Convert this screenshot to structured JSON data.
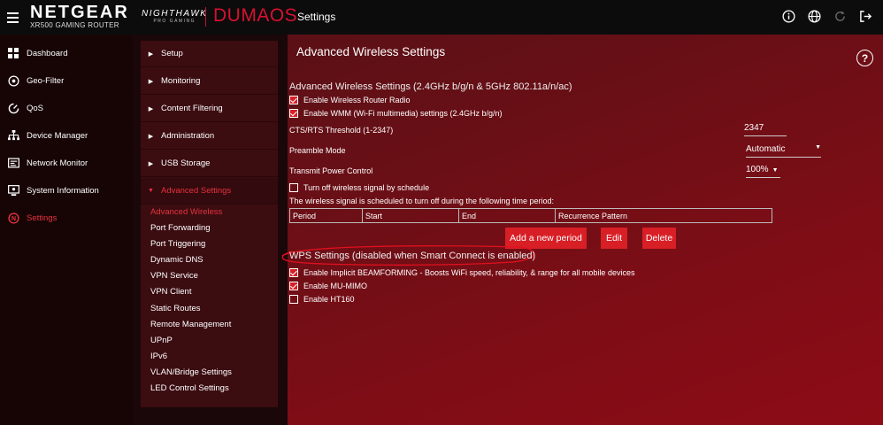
{
  "header": {
    "brand": "NETGEAR",
    "model": "XR500 GAMING ROUTER",
    "nighthawk": "NIGHTHAWK",
    "pro_gaming": "PRO GAMING",
    "os_part1": "DUMA",
    "os_part2": "OS",
    "app_title": "Settings",
    "icons": [
      "info-icon",
      "globe-icon",
      "refresh-icon",
      "logout-icon"
    ]
  },
  "nav": {
    "items": [
      {
        "label": "Dashboard",
        "icon": "dashboard-icon"
      },
      {
        "label": "Geo-Filter",
        "icon": "geo-filter-icon"
      },
      {
        "label": "QoS",
        "icon": "qos-icon"
      },
      {
        "label": "Device Manager",
        "icon": "device-manager-icon"
      },
      {
        "label": "Network Monitor",
        "icon": "network-monitor-icon"
      },
      {
        "label": "System Information",
        "icon": "system-info-icon"
      },
      {
        "label": "Settings",
        "icon": "settings-icon"
      }
    ]
  },
  "submenu": {
    "sections": [
      "Setup",
      "Monitoring",
      "Content Filtering",
      "Administration",
      "USB Storage",
      "Advanced Settings"
    ],
    "children": [
      "Advanced Wireless",
      "Port Forwarding",
      "Port Triggering",
      "Dynamic DNS",
      "VPN Service",
      "VPN Client",
      "Static Routes",
      "Remote Management",
      "UPnP",
      "IPv6",
      "VLAN/Bridge Settings",
      "LED Control Settings"
    ]
  },
  "main": {
    "title": "Advanced Wireless Settings",
    "section_title": "Advanced Wireless Settings (2.4GHz b/g/n & 5GHz 802.11a/n/ac)",
    "enable_radio": "Enable Wireless Router Radio",
    "enable_wmm": "Enable WMM (Wi-Fi multimedia) settings (2.4GHz b/g/n)",
    "cts_label": "CTS/RTS Threshold (1-2347)",
    "cts_value": "2347",
    "preamble_label": "Preamble Mode",
    "preamble_value": "Automatic",
    "power_label": "Transmit Power Control",
    "power_value": "100%",
    "schedule_label": "Turn off wireless signal by schedule",
    "schedule_desc": "The wireless signal is scheduled to turn off during the following time period:",
    "table_headers": [
      "Period",
      "Start",
      "End",
      "Recurrence Pattern"
    ],
    "add_period": "Add a new period",
    "edit": "Edit",
    "delete": "Delete",
    "wps_title": "WPS Settings (disabled when Smart Connect is enabled)",
    "beamforming": "Enable Implicit BEAMFORMING - Boosts WiFi speed, reliability, & range for all mobile devices",
    "mu_mimo": "Enable MU-MIMO",
    "ht160": "Enable HT160"
  },
  "colors": {
    "accent": "#d81f26",
    "active_text": "#e8323d",
    "topbar": "#0c0c0c",
    "annotation": "#e1101e"
  }
}
